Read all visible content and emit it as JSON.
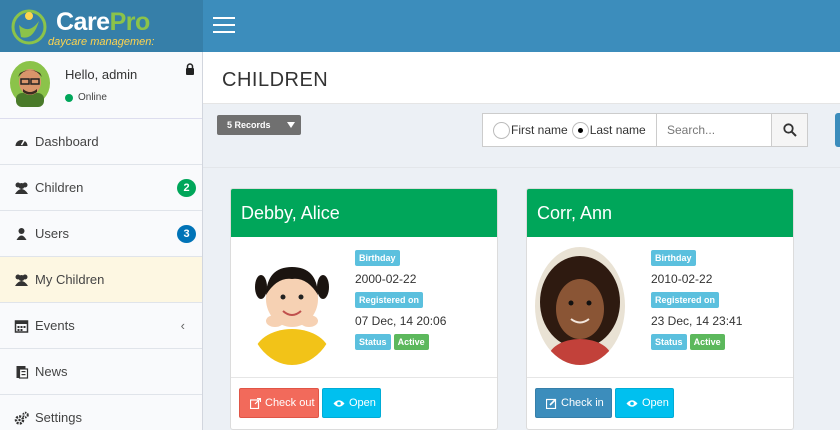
{
  "brand": {
    "name_part1": "Care",
    "name_part2": "Pro",
    "tagline": "daycare managemen:"
  },
  "user_panel": {
    "greeting": "Hello, admin",
    "status": "Online"
  },
  "sidebar": {
    "items": [
      {
        "label": "Dashboard",
        "icon": "dashboard-icon"
      },
      {
        "label": "Children",
        "icon": "users-icon",
        "badge": "2",
        "badge_color": "#00a65a"
      },
      {
        "label": "Users",
        "icon": "user-icon",
        "badge": "3",
        "badge_color": "#0073b7"
      },
      {
        "label": "My Children",
        "icon": "users-icon",
        "active": true
      },
      {
        "label": "Events",
        "icon": "calendar-icon",
        "chevron": "‹"
      },
      {
        "label": "News",
        "icon": "newspaper-icon"
      },
      {
        "label": "Settings",
        "icon": "gears-icon"
      }
    ]
  },
  "page": {
    "title": "CHILDREN"
  },
  "toolbar": {
    "records_select": "5 Records",
    "radio_first": "First name",
    "radio_last": "Last name",
    "search_placeholder": "Search..."
  },
  "cards": [
    {
      "name": "Debby, Alice",
      "birthday_label": "Birthday",
      "birthday": "2000-02-22",
      "registered_label": "Registered on",
      "registered": "07 Dec, 14 20:06",
      "status_label": "Status",
      "status": "Active",
      "primary_action": "Check out",
      "open_action": "Open"
    },
    {
      "name": "Corr, Ann",
      "birthday_label": "Birthday",
      "birthday": "2010-02-22",
      "registered_label": "Registered on",
      "registered": "23 Dec, 14 23:41",
      "status_label": "Status",
      "status": "Active",
      "primary_action": "Check in",
      "open_action": "Open"
    }
  ],
  "colors": {
    "topbar": "#3c8dbc",
    "card_header": "#00a65a",
    "checkout": "#f26a5b",
    "checkin": "#3c8dbc",
    "open": "#00c0ef"
  }
}
